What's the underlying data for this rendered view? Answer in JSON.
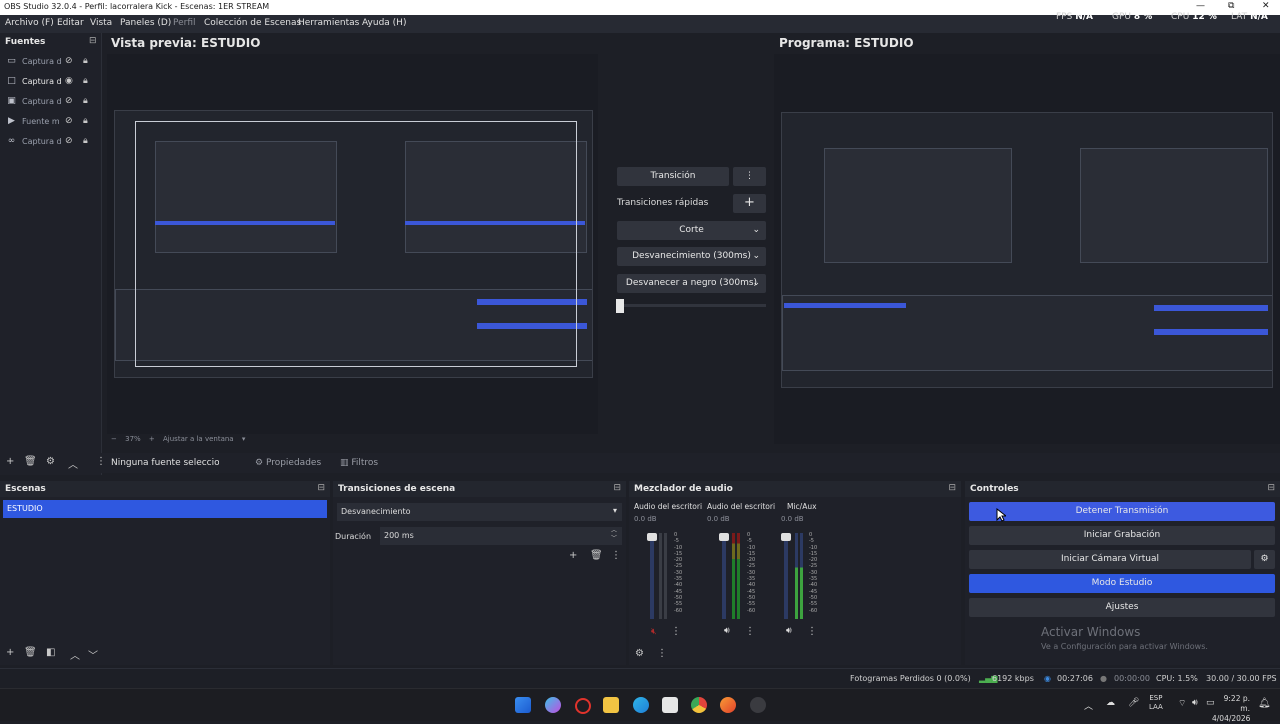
{
  "window": {
    "title": "OBS Studio 32.0.4 - Perfil: lacorralera Kick - Escenas: 1ER STREAM",
    "minimize": "—",
    "maximize": "⧉",
    "close": "✕"
  },
  "menu": [
    "Archivo (F)",
    "Editar",
    "Vista",
    "Paneles (D)",
    "Perfil",
    "Colección de Escenas",
    "Herramientas",
    "Ayuda (H)"
  ],
  "stats": {
    "fps_label": "FPS",
    "fps_value": "N/A",
    "gpu_label": "GPU",
    "gpu_value": "8 %",
    "cpu_label": "CPU",
    "cpu_value": "12 %",
    "lat_label": "LAT",
    "lat_value": "N/A"
  },
  "sources": {
    "title": "Fuentes",
    "items": [
      {
        "label": "Captura d",
        "icon": "monitor-icon"
      },
      {
        "label": "Captura d",
        "icon": "window-icon"
      },
      {
        "label": "Captura d",
        "icon": "monitor-icon"
      },
      {
        "label": "Fuente m",
        "icon": "play-icon"
      },
      {
        "label": "Captura d",
        "icon": "link-icon"
      }
    ]
  },
  "preview": {
    "title": "Vista previa: ESTUDIO",
    "zoom": "37%",
    "fit": "Ajustar a la ventana"
  },
  "program": {
    "title": "Programa: ESTUDIO"
  },
  "transition_panel": {
    "transition_button": "Transición",
    "quick_label": "Transiciones rápidas",
    "items": [
      "Corte",
      "Desvanecimiento (300ms)",
      "Desvanecer a negro (300ms)"
    ]
  },
  "context_bar": {
    "no_source": "Ninguna fuente seleccionar",
    "properties": "Propiedades",
    "filters": "Filtros"
  },
  "scenes": {
    "title": "Escenas",
    "items": [
      "ESTUDIO"
    ]
  },
  "scene_transitions": {
    "title": "Transiciones de escena",
    "selected": "Desvanecimiento",
    "duration_label": "Duración",
    "duration_value": "200 ms"
  },
  "mixer": {
    "title": "Mezclador de audio",
    "channels": [
      {
        "name": "Audio del escritorio",
        "db": "0.0 dB"
      },
      {
        "name": "Audio del escritorio",
        "db": "0.0 dB"
      },
      {
        "name": "Mic/Aux",
        "db": "0.0 dB"
      }
    ],
    "scale": [
      "0",
      "-5",
      "-10",
      "-15",
      "-20",
      "-25",
      "-30",
      "-35",
      "-40",
      "-45",
      "-50",
      "-55",
      "-60"
    ]
  },
  "controls": {
    "title": "Controles",
    "stop_stream": "Detener Transmisión",
    "start_recording": "Iniciar Grabación",
    "start_virtual_cam": "Iniciar Cámara Virtual",
    "studio_mode": "Modo Estudio",
    "settings": "Ajustes"
  },
  "watermark": {
    "title": "Activar Windows",
    "subtitle": "Ve a Configuración para activar Windows."
  },
  "statusbar": {
    "dropped": "Fotogramas Perdidos 0 (0.0%)",
    "bitrate": "6192 kbps",
    "stream_time": "00:27:06",
    "rec_time": "00:00:00",
    "cpu": "CPU: 1.5%",
    "fps": "30.00 / 30.00 FPS"
  },
  "taskbar": {
    "lang1": "ESP",
    "lang2": "LAA",
    "time": "9:22 p. m.",
    "date": "4/04/2026"
  },
  "colors": {
    "accent": "#3d5ae0",
    "panel": "#1f2129",
    "bg": "#1d1f26"
  }
}
